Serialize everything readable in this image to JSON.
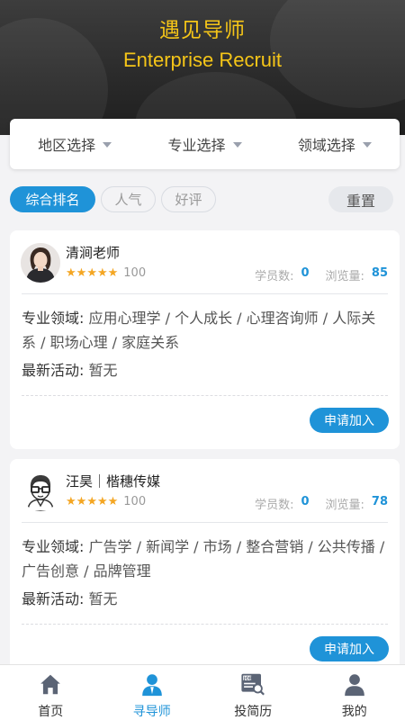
{
  "header": {
    "title": "遇见导师",
    "subtitle": "Enterprise Recruit"
  },
  "filters": [
    {
      "label": "地区选择"
    },
    {
      "label": "专业选择"
    },
    {
      "label": "领域选择"
    }
  ],
  "sort": {
    "options": [
      "综合排名",
      "人气",
      "好评"
    ],
    "active": "综合排名",
    "reset_label": "重置"
  },
  "mentors": [
    {
      "name": "清涧老师",
      "rating": 5,
      "score": "100",
      "students_label": "学员数:",
      "students": "0",
      "views_label": "浏览量:",
      "views": "85",
      "field_label": "专业领域:",
      "fields": "应用心理学 / 个人成长 / 心理咨询师 / 人际关系 / 职场心理 / 家庭关系",
      "activity_label": "最新活动:",
      "activity": "暂无",
      "apply_label": "申请加入"
    },
    {
      "name": "汪昊｜楷穗传媒",
      "rating": 5,
      "score": "100",
      "students_label": "学员数:",
      "students": "0",
      "views_label": "浏览量:",
      "views": "78",
      "field_label": "专业领域:",
      "fields": "广告学 / 新闻学 / 市场 / 整合营销 / 公共传播 / 广告创意 / 品牌管理",
      "activity_label": "最新活动:",
      "activity": "暂无",
      "apply_label": "申请加入"
    }
  ],
  "tabbar": {
    "items": [
      {
        "label": "首页",
        "icon": "home-icon"
      },
      {
        "label": "寻导师",
        "icon": "mentor-icon"
      },
      {
        "label": "投简历",
        "icon": "job-resume-icon"
      },
      {
        "label": "我的",
        "icon": "user-icon"
      }
    ],
    "active": "寻导师"
  },
  "colors": {
    "accent": "#1f93d8",
    "title": "#f5c518",
    "star": "#f4a623"
  }
}
